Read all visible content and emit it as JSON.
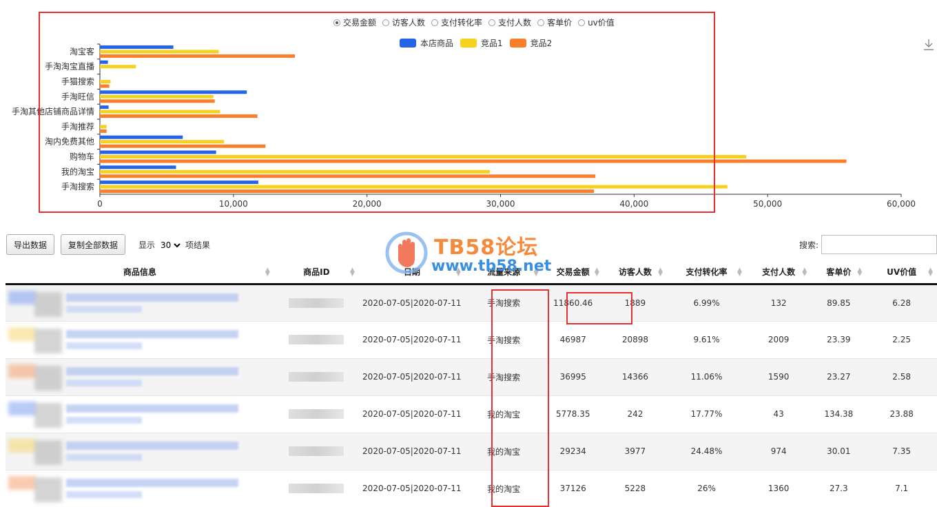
{
  "metric_options": [
    {
      "label": "交易金额",
      "checked": true
    },
    {
      "label": "访客人数",
      "checked": false
    },
    {
      "label": "支付转化率",
      "checked": false
    },
    {
      "label": "支付人数",
      "checked": false
    },
    {
      "label": "客单价",
      "checked": false
    },
    {
      "label": "uv价值",
      "checked": false
    }
  ],
  "chart_data": {
    "type": "bar",
    "orientation": "horizontal",
    "categories": [
      "淘宝客",
      "手淘淘宝直播",
      "手猫搜索",
      "手淘旺信",
      "手淘其他店铺商品详情",
      "手淘推荐",
      "淘内免费其他",
      "购物车",
      "我的淘宝",
      "手淘搜索"
    ],
    "series": [
      {
        "name": "本店商品",
        "color": "#2563e8",
        "values": [
          5500,
          600,
          0,
          11000,
          650,
          0,
          6200,
          8700,
          5700,
          11860
        ]
      },
      {
        "name": "竞品1",
        "color": "#f5d21f",
        "values": [
          8900,
          2700,
          800,
          8500,
          9000,
          500,
          9300,
          48400,
          29200,
          46987
        ]
      },
      {
        "name": "竞品2",
        "color": "#fa7f2d",
        "values": [
          14600,
          0,
          700,
          8600,
          11800,
          500,
          12400,
          55900,
          37100,
          36995
        ]
      }
    ],
    "xlim": [
      0,
      60000
    ],
    "xticks": [
      "0",
      "10,000",
      "20,000",
      "30,000",
      "40,000",
      "50,000",
      "60,000"
    ],
    "legend_position": "top-center",
    "grid": false
  },
  "toolbar": {
    "export_label": "导出数据",
    "copy_label": "复制全部数据",
    "show_prefix": "显示",
    "page_size": "30",
    "show_suffix": "项结果",
    "search_label": "搜索:"
  },
  "watermark": {
    "line1": "TB58论坛",
    "line2": "www.tb58.net"
  },
  "table": {
    "headers": [
      "商品信息",
      "商品ID",
      "日期",
      "流量来源",
      "交易金额",
      "访客人数",
      "支付转化率",
      "支付人数",
      "客单价",
      "UV价值"
    ],
    "rows": [
      [
        "2020-07-05|2020-07-11",
        "手淘搜索",
        "11860.46",
        "1889",
        "6.99%",
        "132",
        "89.85",
        "6.28"
      ],
      [
        "2020-07-05|2020-07-11",
        "手淘搜索",
        "46987",
        "20898",
        "9.61%",
        "2009",
        "23.39",
        "2.25"
      ],
      [
        "2020-07-05|2020-07-11",
        "手淘搜索",
        "36995",
        "14366",
        "11.06%",
        "1590",
        "23.27",
        "2.58"
      ],
      [
        "2020-07-05|2020-07-11",
        "我的淘宝",
        "5778.35",
        "242",
        "17.77%",
        "43",
        "134.38",
        "23.88"
      ],
      [
        "2020-07-05|2020-07-11",
        "我的淘宝",
        "29234",
        "3977",
        "24.48%",
        "974",
        "30.01",
        "7.35"
      ],
      [
        "2020-07-05|2020-07-11",
        "我的淘宝",
        "37126",
        "5228",
        "26%",
        "1360",
        "27.3",
        "7.1"
      ]
    ],
    "thumb_colors": [
      "#7fa0f0",
      "#f5d870",
      "#f7a070",
      "#7fa0f0",
      "#f5d870",
      "#f7a070"
    ]
  },
  "colors": {
    "highlight": "#e5302d"
  }
}
